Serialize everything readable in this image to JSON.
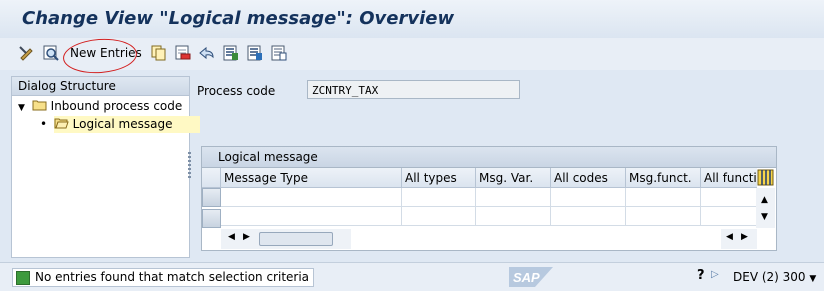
{
  "window": {
    "title": "Change View \"Logical message\": Overview"
  },
  "toolbar": {
    "new_entries_label": "New Entries",
    "icons": [
      "display-change-icon",
      "find-icon",
      "copy-icon",
      "delete-icon",
      "undo-change-icon",
      "select-all-icon",
      "select-block-icon",
      "deselect-all-icon"
    ]
  },
  "dialog_structure": {
    "header": "Dialog Structure",
    "items": [
      {
        "label": "Inbound process code",
        "level": 0,
        "expanded": true
      },
      {
        "label": "Logical message",
        "level": 1,
        "selected": true
      }
    ]
  },
  "main": {
    "process_code_label": "Process code",
    "process_code_value": "ZCNTRY_TAX",
    "table": {
      "title": "Logical message",
      "columns": [
        "Message Type",
        "All types",
        "Msg. Var.",
        "All codes",
        "Msg.funct.",
        "All functio"
      ],
      "rows": [
        [
          "",
          "",
          "",
          "",
          "",
          ""
        ],
        [
          "",
          "",
          "",
          "",
          "",
          ""
        ]
      ]
    }
  },
  "status_bar": {
    "message": "No entries found that match selection criteria",
    "logo": "SAP",
    "system": "DEV (2) 300"
  },
  "colors": {
    "title": "#14325c",
    "annotation": "#d32020",
    "selected": "#fff9c4"
  }
}
